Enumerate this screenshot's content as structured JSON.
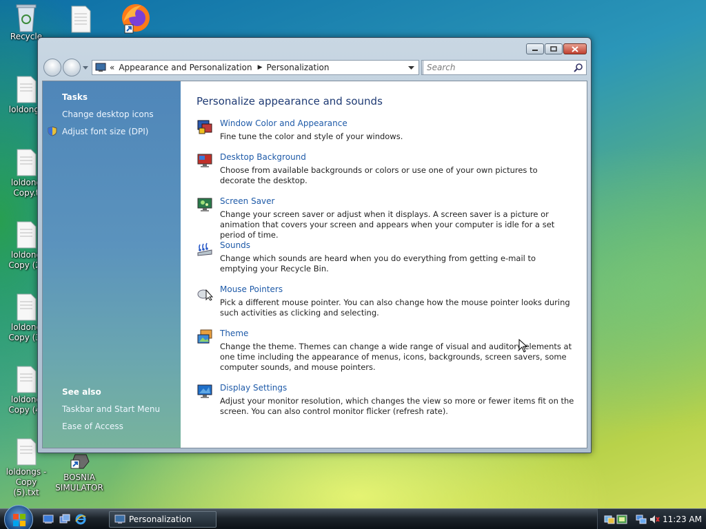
{
  "desktop": {
    "icons": [
      {
        "label": "Recycle",
        "label2": ""
      },
      {
        "label": "loldongs",
        "label2": ""
      },
      {
        "label": "loldong",
        "label2": "Copy.t"
      },
      {
        "label": "loldong",
        "label2": "Copy (2)"
      },
      {
        "label": "loldong",
        "label2": "Copy (3)"
      },
      {
        "label": "loldong",
        "label2": "Copy (4)"
      },
      {
        "label": "loldongs -",
        "label2": "Copy (5).txt"
      },
      {
        "label": "BOSNIA",
        "label2": "SIMULATOR"
      }
    ]
  },
  "window": {
    "breadcrumb": [
      "Appearance and Personalization",
      "Personalization"
    ],
    "search_placeholder": "Search",
    "sidebar": {
      "tasks_heading": "Tasks",
      "tasks": [
        "Change desktop icons",
        "Adjust font size (DPI)"
      ],
      "see_also_heading": "See also",
      "see_also": [
        "Taskbar and Start Menu",
        "Ease of Access"
      ]
    },
    "main": {
      "heading": "Personalize appearance and sounds",
      "items": [
        {
          "title": "Window Color and Appearance",
          "desc": "Fine tune the color and style of your windows.",
          "icon": "window-color-icon"
        },
        {
          "title": "Desktop Background",
          "desc": "Choose from available backgrounds or colors or use one of your own pictures to decorate the desktop.",
          "icon": "desktop-background-icon"
        },
        {
          "title": "Screen Saver",
          "desc": "Change your screen saver or adjust when it displays. A screen saver is a picture or animation that covers your screen and appears when your computer is idle for a set period of time.",
          "icon": "screen-saver-icon"
        },
        {
          "title": "Sounds",
          "desc": "Change which sounds are heard when you do everything from getting e-mail to emptying your Recycle Bin.",
          "icon": "sounds-icon"
        },
        {
          "title": "Mouse Pointers",
          "desc": "Pick a different mouse pointer. You can also change how the mouse pointer looks during such activities as clicking and selecting.",
          "icon": "mouse-pointers-icon"
        },
        {
          "title": "Theme",
          "desc": "Change the theme. Themes can change a wide range of visual and auditory elements at one time including the appearance of menus, icons, backgrounds, screen savers, some computer sounds, and mouse pointers.",
          "icon": "theme-icon"
        },
        {
          "title": "Display Settings",
          "desc": "Adjust your monitor resolution, which changes the view so more or fewer items fit on the screen. You can also control monitor flicker (refresh rate).",
          "icon": "display-settings-icon"
        }
      ]
    }
  },
  "taskbar": {
    "window_button": "Personalization",
    "clock": "11:23 AM"
  }
}
